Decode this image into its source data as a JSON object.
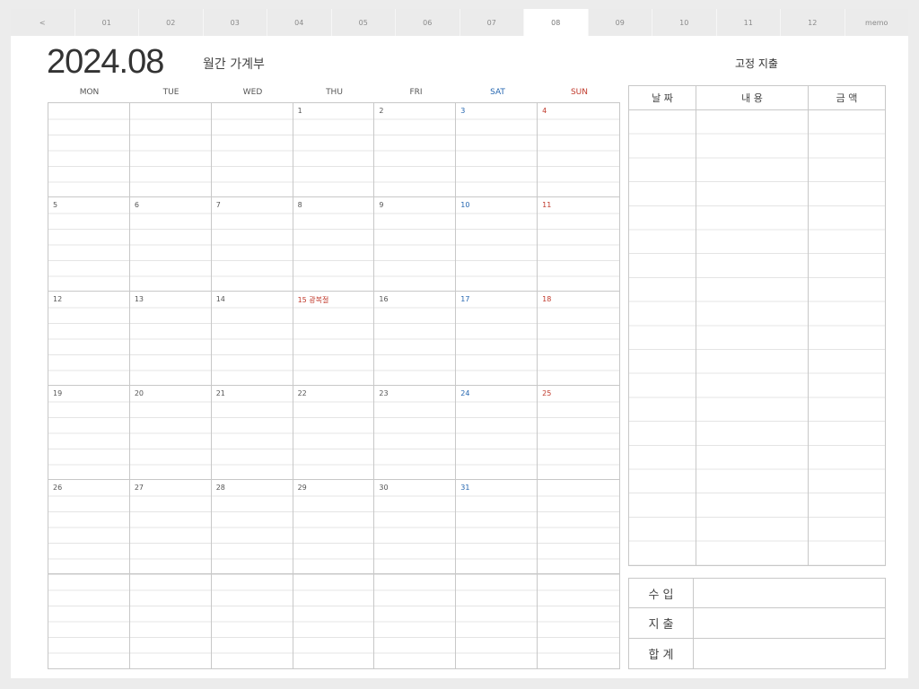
{
  "tabs": [
    {
      "label": "<"
    },
    {
      "label": "01"
    },
    {
      "label": "02"
    },
    {
      "label": "03"
    },
    {
      "label": "04"
    },
    {
      "label": "05"
    },
    {
      "label": "06"
    },
    {
      "label": "07"
    },
    {
      "label": "08"
    },
    {
      "label": "09"
    },
    {
      "label": "10"
    },
    {
      "label": "11"
    },
    {
      "label": "12"
    },
    {
      "label": "memo"
    }
  ],
  "active_tab": "08",
  "header": {
    "year_month": "2024.08",
    "subtitle": "월간 가계부",
    "fixed_expenses_title": "고정 지출"
  },
  "weekdays": [
    "MON",
    "TUE",
    "WED",
    "THU",
    "FRI",
    "SAT",
    "SUN"
  ],
  "calendar": {
    "cells": [
      "",
      "",
      "",
      "1",
      "2",
      "3",
      "4",
      "5",
      "6",
      "7",
      "8",
      "9",
      "10",
      "11",
      "12",
      "13",
      "14",
      "15 광복절",
      "16",
      "17",
      "18",
      "19",
      "20",
      "21",
      "22",
      "23",
      "24",
      "25",
      "26",
      "27",
      "28",
      "29",
      "30",
      "31",
      "",
      "",
      "",
      "",
      "",
      "",
      "",
      ""
    ],
    "holiday_cells": [
      17
    ]
  },
  "fixed_expenses": {
    "columns": [
      "날 짜",
      "내 용",
      "금 액"
    ]
  },
  "summary": {
    "rows": [
      {
        "label": "수 입",
        "value": ""
      },
      {
        "label": "지 출",
        "value": ""
      },
      {
        "label": "합 계",
        "value": ""
      }
    ]
  },
  "colors": {
    "saturday": "#2566b0",
    "sunday": "#c0392b",
    "grid_line": "#c8c8c8",
    "background": "#ececec"
  }
}
